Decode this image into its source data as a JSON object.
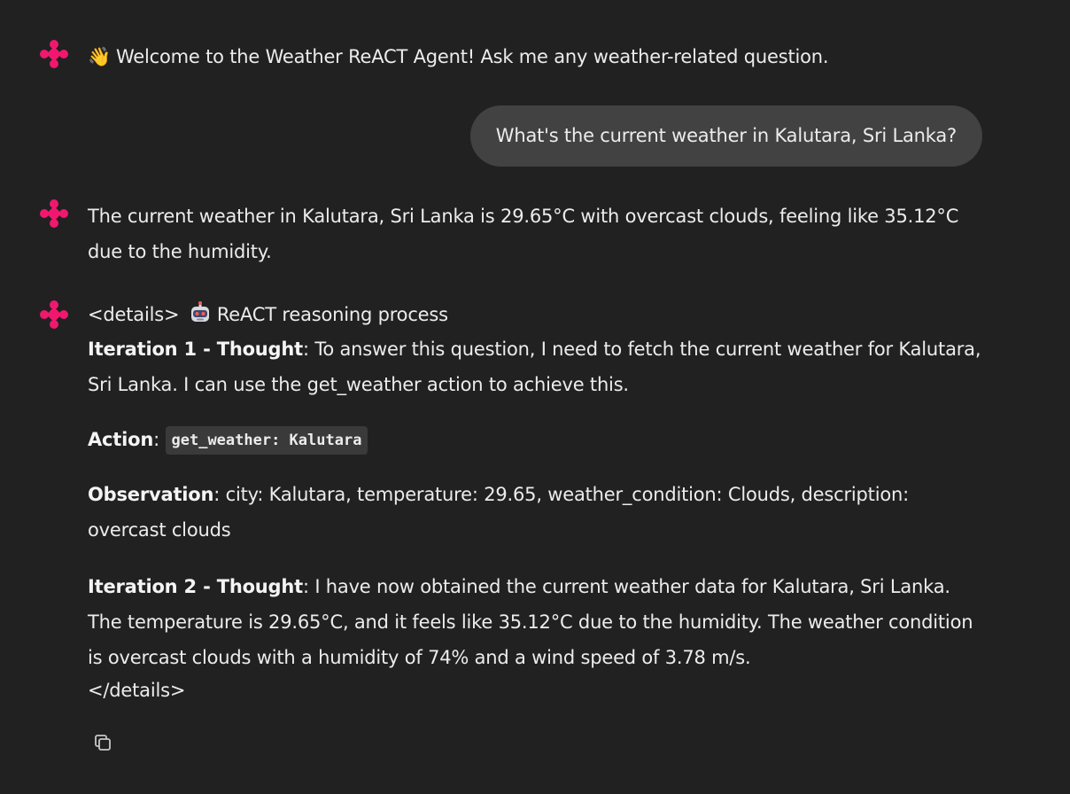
{
  "messages": {
    "welcome": {
      "emoji": "👋",
      "text": "Welcome to the Weather ReACT Agent! Ask me any weather-related question."
    },
    "user_question": "What's the current weather in Kalutara, Sri Lanka?",
    "answer": "The current weather in Kalutara, Sri Lanka is 29.65°C with overcast clouds, feeling like 35.12°C due to the humidity.",
    "reasoning": {
      "details_open": "<details>",
      "title": "ReACT reasoning process",
      "iteration1_label": "Iteration 1 - Thought",
      "iteration1_text": ": To answer this question, I need to fetch the current weather for Kalutara, Sri Lanka. I can use the get_weather action to achieve this.",
      "action_label": "Action",
      "action_sep": ":",
      "action_code": "get_weather: Kalutara",
      "observation_label": "Observation",
      "observation_text": ": city: Kalutara, temperature: 29.65, weather_condition: Clouds, description: overcast clouds",
      "iteration2_label": "Iteration 2 - Thought",
      "iteration2_text": ": I have now obtained the current weather data for Kalutara, Sri Lanka. The temperature is 29.65°C, and it feels like 35.12°C due to the humidity. The weather condition is overcast clouds with a humidity of 74% and a wind speed of 3.78 m/s.",
      "details_close": "</details>"
    }
  },
  "icons": {
    "avatar": "agent-logo-icon",
    "robot": "robot-icon",
    "copy": "copy-icon"
  },
  "colors": {
    "background": "#212121",
    "user_bubble": "#424242",
    "avatar_accent": "#f0186e",
    "text": "#ececec"
  }
}
